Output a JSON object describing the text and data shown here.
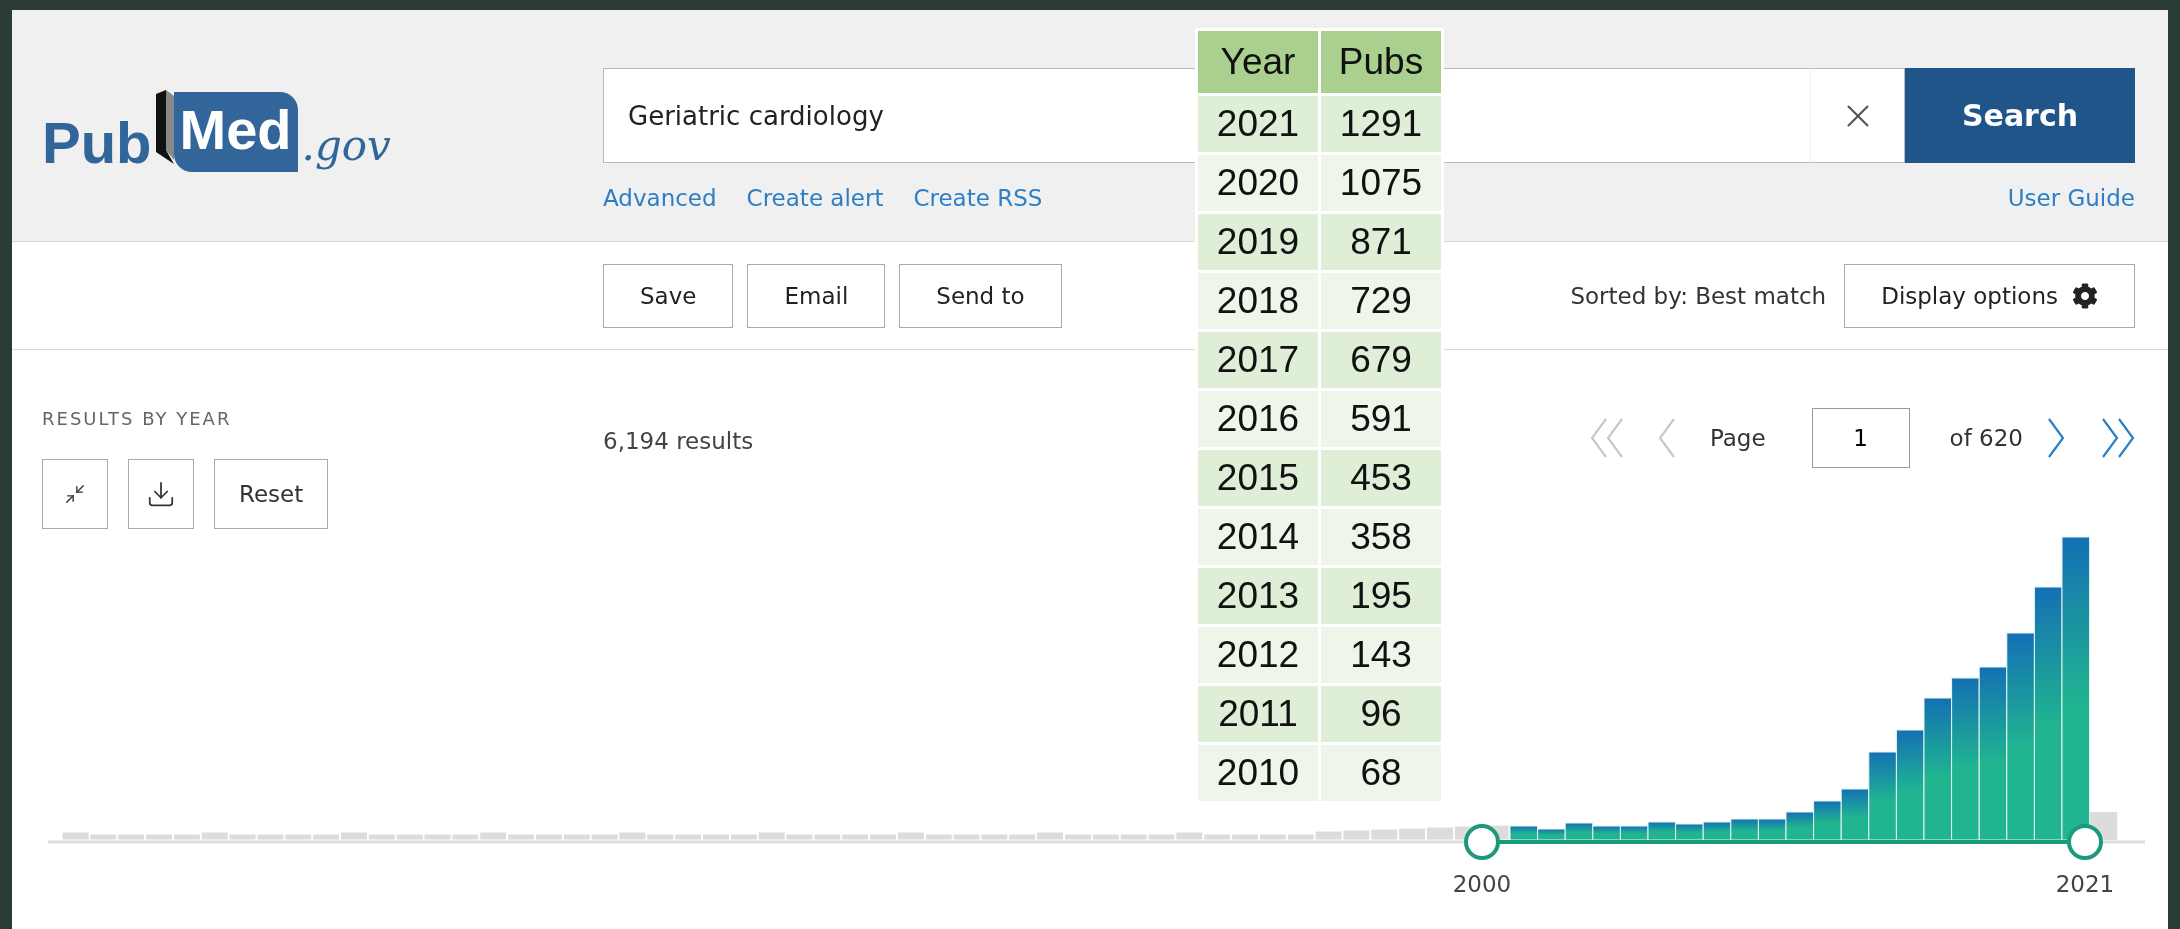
{
  "logo": {
    "part_1": "Pub",
    "part_2": "Med",
    "domain": ".gov"
  },
  "search": {
    "value": "Geriatric cardiology",
    "button": "Search",
    "links": [
      "Advanced",
      "Create alert",
      "Create RSS"
    ],
    "help_link": "User Guide"
  },
  "toolbar": {
    "actions": [
      "Save",
      "Email",
      "Send to"
    ],
    "sort_label": "Sorted by: Best match",
    "display_button": "Display options"
  },
  "timeline": {
    "title": "RESULTS BY YEAR",
    "reset": "Reset",
    "range_start": "2000",
    "range_end": "2021"
  },
  "results": {
    "count": "6,194 results"
  },
  "pagination": {
    "page_label": "Page",
    "page_value": "1",
    "of_label": "of 620",
    "buttons": [
      {
        "kind": "first",
        "disabled": true
      },
      {
        "kind": "prev",
        "disabled": true
      },
      {
        "kind": "next",
        "disabled": false
      },
      {
        "kind": "last",
        "disabled": false
      }
    ]
  },
  "overlay_table": {
    "columns": [
      "Year",
      "Pubs"
    ],
    "rows": [
      [
        "2021",
        "1291"
      ],
      [
        "2020",
        "1075"
      ],
      [
        "2019",
        "871"
      ],
      [
        "2018",
        "729"
      ],
      [
        "2017",
        "679"
      ],
      [
        "2016",
        "591"
      ],
      [
        "2015",
        "453"
      ],
      [
        "2014",
        "358"
      ],
      [
        "2013",
        "195"
      ],
      [
        "2012",
        "143"
      ],
      [
        "2011",
        "96"
      ],
      [
        "2010",
        "68"
      ]
    ]
  }
}
